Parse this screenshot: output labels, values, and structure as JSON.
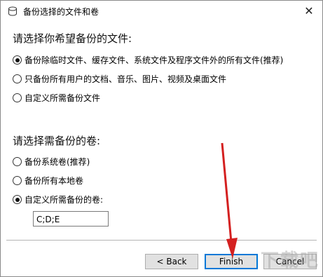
{
  "window": {
    "title": "备份选择的文件和卷",
    "close_glyph": "✕"
  },
  "files_section": {
    "heading": "请选择你希望备份的文件:",
    "options": [
      {
        "label": "备份除临时文件、缓存文件、系统文件及程序文件外的所有文件(推荐)",
        "checked": true
      },
      {
        "label": "只备份所有用户的文档、音乐、图片、视频及桌面文件",
        "checked": false
      },
      {
        "label": "自定义所需备份文件",
        "checked": false
      }
    ]
  },
  "volumes_section": {
    "heading": "请选择需备份的卷:",
    "options": [
      {
        "label": "备份系统卷(推荐)",
        "checked": false
      },
      {
        "label": "备份所有本地卷",
        "checked": false
      },
      {
        "label": "自定义所需备份的卷:",
        "checked": true
      }
    ],
    "custom_value": "C;D;E"
  },
  "buttons": {
    "back": "< Back",
    "finish": "Finish",
    "cancel": "Cancel"
  },
  "watermark_text": "下载吧",
  "colors": {
    "accent": "#0078d7",
    "arrow": "#d42020"
  }
}
